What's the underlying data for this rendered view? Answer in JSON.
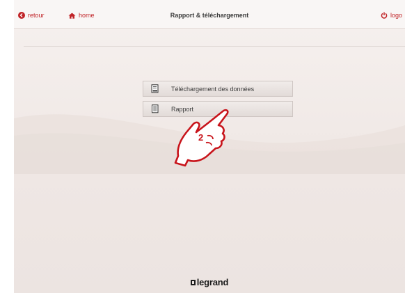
{
  "header": {
    "back_label": "retour",
    "home_label": "home",
    "title": "Rapport & téléchargement",
    "logout_label": "logo"
  },
  "menu": {
    "items": [
      {
        "label": "Téléchargement des données",
        "icon": "download-data-icon"
      },
      {
        "label": "Rapport",
        "icon": "report-document-icon"
      }
    ]
  },
  "annotation": {
    "step_number": "2"
  },
  "footer": {
    "brand": "legrand"
  },
  "colors": {
    "accent": "#c02327",
    "background": "#f3ece9",
    "button_bg": "#e8e1de",
    "text": "#3b3b3b"
  }
}
